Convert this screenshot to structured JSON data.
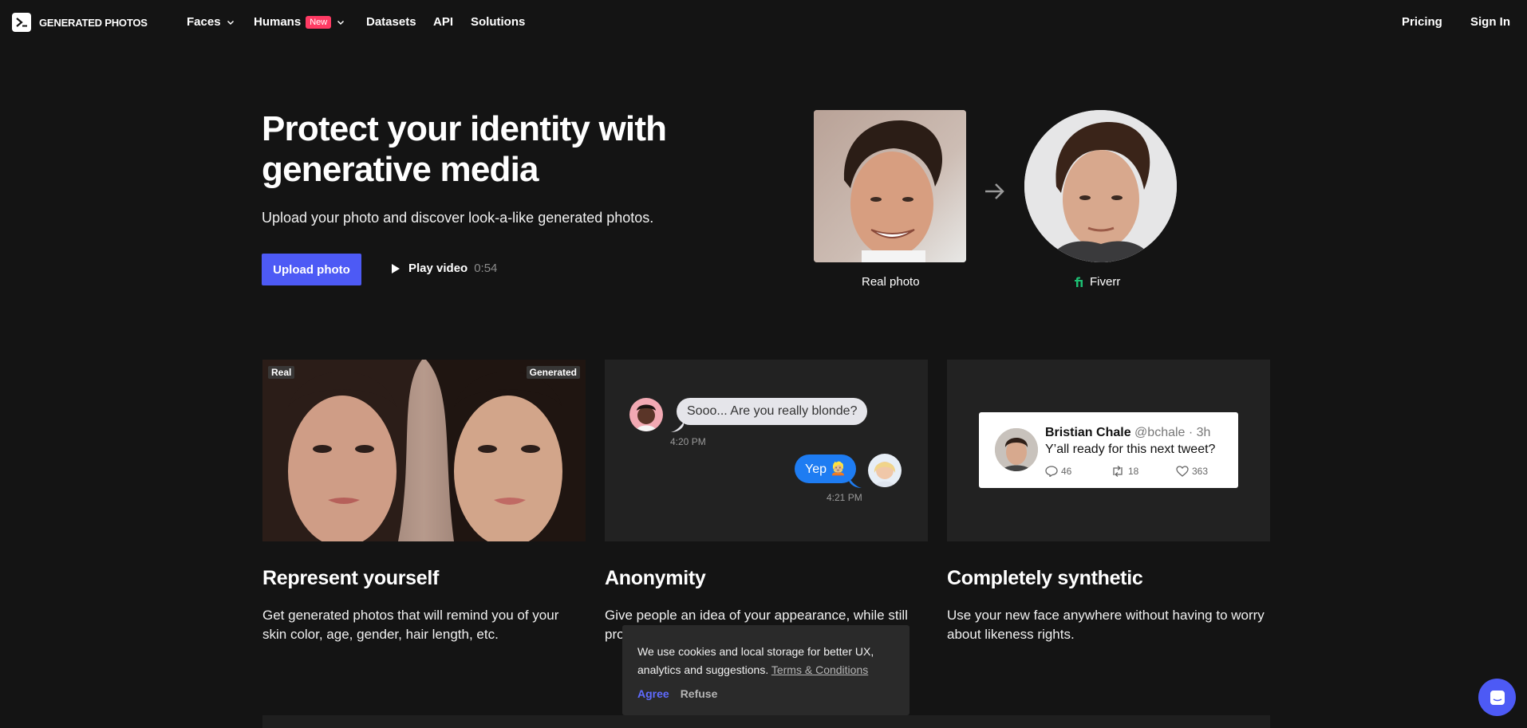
{
  "nav": {
    "brand": "GENERATED PHOTOS",
    "items": [
      {
        "label": "Faces",
        "has_dropdown": true
      },
      {
        "label": "Humans",
        "badge": "New",
        "has_dropdown": true
      },
      {
        "label": "Datasets"
      },
      {
        "label": "API"
      },
      {
        "label": "Solutions"
      }
    ],
    "pricing": "Pricing",
    "sign_in": "Sign In"
  },
  "hero": {
    "title": "Protect your identity with generative media",
    "subtitle": "Upload your photo and discover look-a-like generated photos.",
    "upload_button": "Upload photo",
    "play_label": "Play video",
    "play_duration": "0:54",
    "real_caption": "Real photo",
    "generated_caption": "Fiverr"
  },
  "cards": [
    {
      "title": "Represent yourself",
      "desc": "Get generated photos that will remind you of your skin color, age, gender, hair length, etc.",
      "tag_left": "Real",
      "tag_right": "Generated"
    },
    {
      "title": "Anonymity",
      "desc": "Give people an idea of your appearance, while still pro",
      "chat_in": "Sooo... Are you really blonde?",
      "chat_in_time": "4:20 PM",
      "chat_out": "Yep 👱🏼",
      "chat_out_time": "4:21 PM"
    },
    {
      "title": "Completely synthetic",
      "desc": "Use your new face anywhere without having to worry about likeness rights.",
      "tweet_name": "Bristian Chale",
      "tweet_handle": "@bchale · 3h",
      "tweet_text": "Y’all ready for this next tweet?",
      "tweet_replies": "46",
      "tweet_retweets": "18",
      "tweet_likes": "363"
    }
  ],
  "cookie": {
    "text": "We use cookies and local storage for better UX, analytics and suggestions.",
    "link": "Terms & Conditions",
    "agree": "Agree",
    "refuse": "Refuse"
  },
  "colors": {
    "background": "#141414",
    "accent": "#4d5af5",
    "badge": "#ff3b64",
    "fiverr_green": "#1dbf73"
  }
}
